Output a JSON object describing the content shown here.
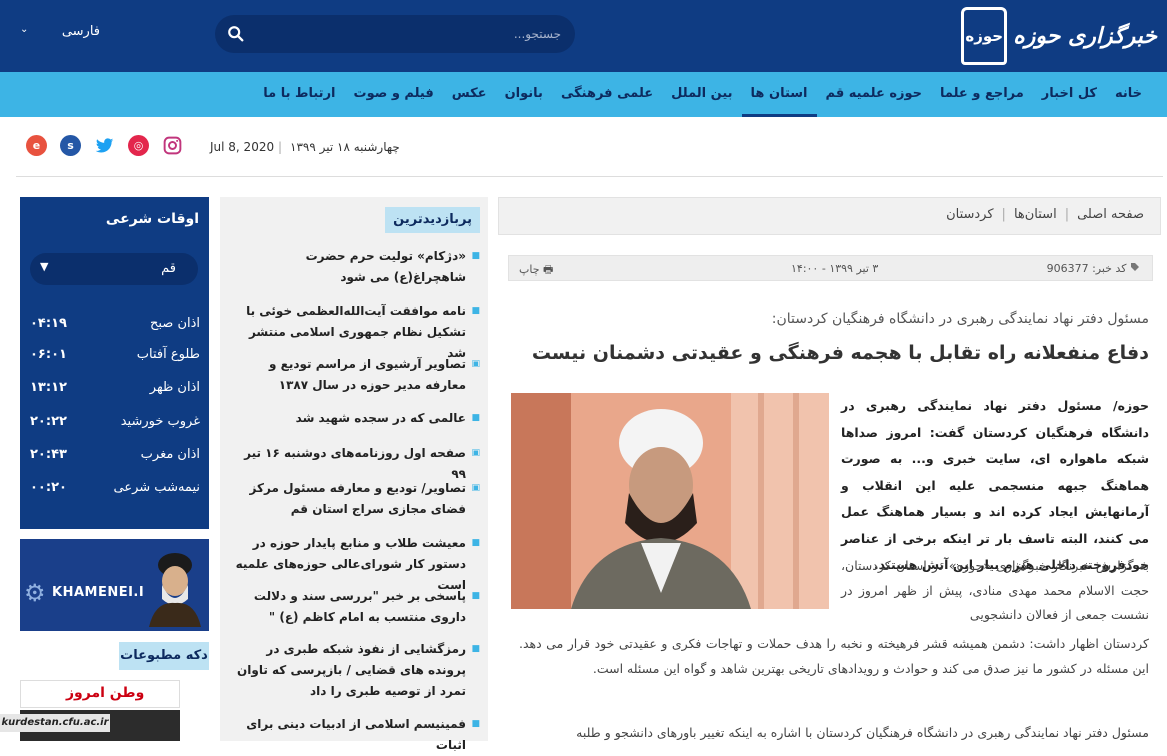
{
  "header": {
    "logo_mark": "حوزه",
    "logo_text": "خبرگزاری حوزه",
    "search_placeholder": "جستجو...",
    "language": "فارسی"
  },
  "nav": {
    "items": [
      {
        "label": "خانه"
      },
      {
        "label": "کل اخبار"
      },
      {
        "label": "مراجع و علما"
      },
      {
        "label": "حوزه علمیه قم"
      },
      {
        "label": "استان ها",
        "active": true
      },
      {
        "label": "بین الملل"
      },
      {
        "label": "علمی فرهنگی"
      },
      {
        "label": "بانوان"
      },
      {
        "label": "عکس"
      },
      {
        "label": "فیلم و صوت"
      },
      {
        "label": "ارتباط با ما"
      }
    ]
  },
  "date_bar": {
    "persian_date": "چهارشنبه ۱۸ تیر ۱۳۹۹",
    "separator": "|",
    "gregorian_date": "Jul 8, 2020",
    "socials": [
      "eitaa-icon",
      "soroush-icon",
      "twitter-icon",
      "aparat-icon",
      "instagram-icon"
    ]
  },
  "prayer_times": {
    "title": "اوقات شرعی",
    "city": "قم",
    "rows": [
      {
        "name": "اذان صبح",
        "time": "۰۴:۱۹"
      },
      {
        "name": "طلوع آفتاب",
        "time": "۰۶:۰۱"
      },
      {
        "name": "اذان ظهر",
        "time": "۱۳:۱۲"
      },
      {
        "name": "غروب خورشید",
        "time": "۲۰:۲۲"
      },
      {
        "name": "اذان مغرب",
        "time": "۲۰:۴۳"
      },
      {
        "name": "نیمه‌شب شرعی",
        "time": "۰۰:۲۰"
      }
    ]
  },
  "banner": {
    "text": "KHAMENEI.IR"
  },
  "publications": {
    "title": "دکه مطبوعات",
    "paper_name": "وطن امروز",
    "url_overlay": "kurdestan.cfu.ac.ir"
  },
  "most_visited": {
    "title": "پربازدیدترین",
    "items": [
      {
        "text": "«دژکام» تولیت حرم حضرت شاهچراغ(ع) می شود",
        "icon": "bullet"
      },
      {
        "text": "نامه موافقت آیت‌الله‌العظمی خوئی با تشکیل نظام جمهوری اسلامی منتشر شد",
        "icon": "bullet"
      },
      {
        "text": "تصاویر آرشیوی از مراسم تودیع و معارفه مدیر حوزه در سال ۱۳۸۷",
        "icon": "camera"
      },
      {
        "text": "عالمی که در سجده شهید شد",
        "icon": "bullet"
      },
      {
        "text": "صفحه اول روزنامه‌های دوشنبه ۱۶ تیر ۹۹",
        "icon": "camera"
      },
      {
        "text": "تصاویر/ تودیع و معارفه مسئول مرکز فضای مجازی سراج استان قم",
        "icon": "camera"
      },
      {
        "text": "معیشت طلاب و منابع پایدار حوزه در دستور کار شورای‌عالی حوزه‌های علمیه است",
        "icon": "bullet"
      },
      {
        "text": "پاسخی بر خبر \"بررسی سند و دلالت داروی منتسب به امام کاظم (ع) \"",
        "icon": "bullet"
      },
      {
        "text": "رمزگشایی از نفوذ شبکه طبری در پرونده های قضایی / بازپرسی که تاوان تمرد از توصیه طبری را داد",
        "icon": "bullet"
      },
      {
        "text": "فمینیسم اسلامی از ادبیات دینی برای اثبات",
        "icon": "bullet"
      }
    ]
  },
  "breadcrumb": [
    "صفحه اصلی",
    "استان‌ها",
    "کردستان"
  ],
  "article": {
    "code_label": "کد خبر: 906377",
    "datetime": "۳ تیر ۱۳۹۹ - ۱۴:۰۰",
    "print_label": "چاپ",
    "subtitle": "مسئول دفتر نهاد نمایندگی رهبری در دانشگاه فرهنگیان کردستان:",
    "headline": "دفاع منفعلانه راه تقابل با هجمه فرهنگی و عقیدتی دشمنان نیست",
    "lead": "حوزه/ مسئول دفتر نهاد نمایندگی رهبری در دانشگاه فرهنگیان کردستان گفت: امروز صدا‌ها شبکه ماهواره ای، سایت خبری و... به صورت هماهنگ جبهه منسجمی علیه این انقلاب و آرمانهایش ایجاد کرده اند و بسیار هماهنگ عمل می کنند، البته تاسف بار تر اینکه برخی از عناصر خودفروخته داخلی هیزم بیار این آتش هستند.",
    "body1": "به گزارش خبرنگار خبرگزاری «حوزه» در استان کردستان، حجت الاسلام محمد مهدی منادی، پیش از ظهر امروز در نشست جمعی از فعالان دانشجویی",
    "body2": "کردستان اظهار داشت: دشمن همیشه قشر فرهیخته و نخبه را هدف حملات و تهاجات فکری و عقیدتی خود قرار می دهد. این مسئله در کشور ما نیز صدق می کند و حوادث و رویدادهای تاریخی بهترین شاهد و گواه این مسئله است.",
    "body3": "مسئول دفتر نهاد نمایندگی رهبری در دانشگاه فرهنگیان کردستان با اشاره به اینکه تغییر باورهای دانشجو و طلبه"
  },
  "colors": {
    "primary": "#0f3c83",
    "nav": "#3db4e5",
    "accent_light": "#bde2f3"
  }
}
